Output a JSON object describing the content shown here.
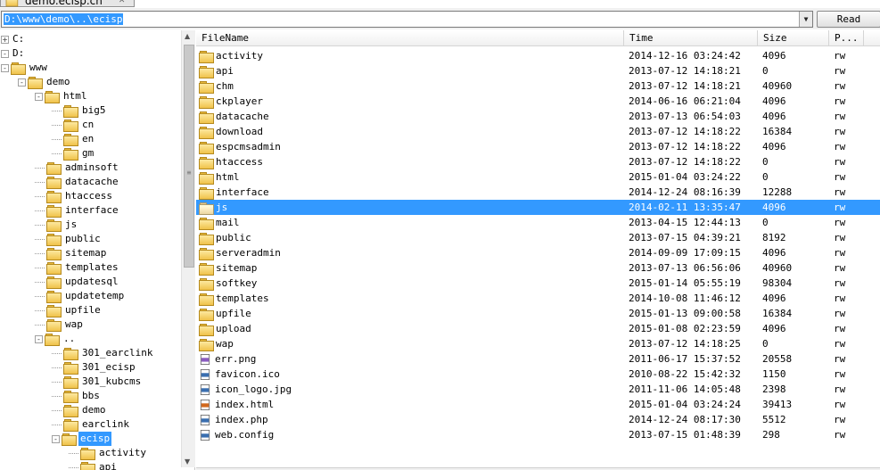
{
  "window": {
    "title": "demo.ecisp.cn"
  },
  "toolbar": {
    "path": "D:\\www\\demo\\..\\ecisp",
    "read_label": "Read"
  },
  "tree": [
    {
      "label": "C:",
      "depth": 0,
      "expander": "+",
      "icon": "drive"
    },
    {
      "label": "D:",
      "depth": 0,
      "expander": "-",
      "icon": "drive"
    },
    {
      "label": "www",
      "depth": 0,
      "expander": "-",
      "icon": "folder",
      "offset": 1
    },
    {
      "label": "demo",
      "depth": 1,
      "expander": "-",
      "icon": "folder"
    },
    {
      "label": "html",
      "depth": 2,
      "expander": "-",
      "icon": "folder"
    },
    {
      "label": "big5",
      "depth": 3,
      "icon": "folder"
    },
    {
      "label": "cn",
      "depth": 3,
      "icon": "folder"
    },
    {
      "label": "en",
      "depth": 3,
      "icon": "folder"
    },
    {
      "label": "gm",
      "depth": 3,
      "icon": "folder"
    },
    {
      "label": "adminsoft",
      "depth": 2,
      "icon": "folder"
    },
    {
      "label": "datacache",
      "depth": 2,
      "icon": "folder"
    },
    {
      "label": "htaccess",
      "depth": 2,
      "icon": "folder"
    },
    {
      "label": "interface",
      "depth": 2,
      "icon": "folder"
    },
    {
      "label": "js",
      "depth": 2,
      "icon": "folder"
    },
    {
      "label": "public",
      "depth": 2,
      "icon": "folder"
    },
    {
      "label": "sitemap",
      "depth": 2,
      "icon": "folder"
    },
    {
      "label": "templates",
      "depth": 2,
      "icon": "folder"
    },
    {
      "label": "updatesql",
      "depth": 2,
      "icon": "folder"
    },
    {
      "label": "updatetemp",
      "depth": 2,
      "icon": "folder"
    },
    {
      "label": "upfile",
      "depth": 2,
      "icon": "folder"
    },
    {
      "label": "wap",
      "depth": 2,
      "icon": "folder"
    },
    {
      "label": "..",
      "depth": 2,
      "expander": "-",
      "icon": "folder"
    },
    {
      "label": "301_earclink",
      "depth": 3,
      "icon": "folder"
    },
    {
      "label": "301_ecisp",
      "depth": 3,
      "icon": "folder"
    },
    {
      "label": "301_kubcms",
      "depth": 3,
      "icon": "folder"
    },
    {
      "label": "bbs",
      "depth": 3,
      "icon": "folder"
    },
    {
      "label": "demo",
      "depth": 3,
      "icon": "folder"
    },
    {
      "label": "earclink",
      "depth": 3,
      "icon": "folder"
    },
    {
      "label": "ecisp",
      "depth": 3,
      "expander": "-",
      "icon": "folder",
      "selected": true
    },
    {
      "label": "activity",
      "depth": 4,
      "icon": "folder"
    },
    {
      "label": "api",
      "depth": 4,
      "icon": "folder"
    }
  ],
  "columns": {
    "filename": "FileName",
    "time": "Time",
    "size": "Size",
    "perm": "P..."
  },
  "files": [
    {
      "name": "activity",
      "time": "2014-12-16 03:24:42",
      "size": "4096",
      "perm": "rw",
      "type": "folder"
    },
    {
      "name": "api",
      "time": "2013-07-12 14:18:21",
      "size": "0",
      "perm": "rw",
      "type": "folder"
    },
    {
      "name": "chm",
      "time": "2013-07-12 14:18:21",
      "size": "40960",
      "perm": "rw",
      "type": "folder"
    },
    {
      "name": "ckplayer",
      "time": "2014-06-16 06:21:04",
      "size": "4096",
      "perm": "rw",
      "type": "folder"
    },
    {
      "name": "datacache",
      "time": "2013-07-13 06:54:03",
      "size": "4096",
      "perm": "rw",
      "type": "folder"
    },
    {
      "name": "download",
      "time": "2013-07-12 14:18:22",
      "size": "16384",
      "perm": "rw",
      "type": "folder"
    },
    {
      "name": "espcmsadmin",
      "time": "2013-07-12 14:18:22",
      "size": "4096",
      "perm": "rw",
      "type": "folder"
    },
    {
      "name": "htaccess",
      "time": "2013-07-12 14:18:22",
      "size": "0",
      "perm": "rw",
      "type": "folder"
    },
    {
      "name": "html",
      "time": "2015-01-04 03:24:22",
      "size": "0",
      "perm": "rw",
      "type": "folder"
    },
    {
      "name": "interface",
      "time": "2014-12-24 08:16:39",
      "size": "12288",
      "perm": "rw",
      "type": "folder"
    },
    {
      "name": "js",
      "time": "2014-02-11 13:35:47",
      "size": "4096",
      "perm": "rw",
      "type": "folder",
      "selected": true
    },
    {
      "name": "mail",
      "time": "2013-04-15 12:44:13",
      "size": "0",
      "perm": "rw",
      "type": "folder"
    },
    {
      "name": "public",
      "time": "2013-07-15 04:39:21",
      "size": "8192",
      "perm": "rw",
      "type": "folder"
    },
    {
      "name": "serveradmin",
      "time": "2014-09-09 17:09:15",
      "size": "4096",
      "perm": "rw",
      "type": "folder"
    },
    {
      "name": "sitemap",
      "time": "2013-07-13 06:56:06",
      "size": "40960",
      "perm": "rw",
      "type": "folder"
    },
    {
      "name": "softkey",
      "time": "2015-01-14 05:55:19",
      "size": "98304",
      "perm": "rw",
      "type": "folder"
    },
    {
      "name": "templates",
      "time": "2014-10-08 11:46:12",
      "size": "4096",
      "perm": "rw",
      "type": "folder"
    },
    {
      "name": "upfile",
      "time": "2015-01-13 09:00:58",
      "size": "16384",
      "perm": "rw",
      "type": "folder"
    },
    {
      "name": "upload",
      "time": "2015-01-08 02:23:59",
      "size": "4096",
      "perm": "rw",
      "type": "folder"
    },
    {
      "name": "wap",
      "time": "2013-07-12 14:18:25",
      "size": "0",
      "perm": "rw",
      "type": "folder"
    },
    {
      "name": "err.png",
      "time": "2011-06-17 15:37:52",
      "size": "20558",
      "perm": "rw",
      "type": "png"
    },
    {
      "name": "favicon.ico",
      "time": "2010-08-22 15:42:32",
      "size": "1150",
      "perm": "rw",
      "type": "ico"
    },
    {
      "name": "icon_logo.jpg",
      "time": "2011-11-06 14:05:48",
      "size": "2398",
      "perm": "rw",
      "type": "jpg"
    },
    {
      "name": "index.html",
      "time": "2015-01-04 03:24:24",
      "size": "39413",
      "perm": "rw",
      "type": "html"
    },
    {
      "name": "index.php",
      "time": "2014-12-24 08:17:30",
      "size": "5512",
      "perm": "rw",
      "type": "php"
    },
    {
      "name": "web.config",
      "time": "2013-07-15 01:48:39",
      "size": "298",
      "perm": "rw",
      "type": "config"
    }
  ],
  "colors": {
    "selection": "#3399ff",
    "folder": "#f0c24a"
  }
}
